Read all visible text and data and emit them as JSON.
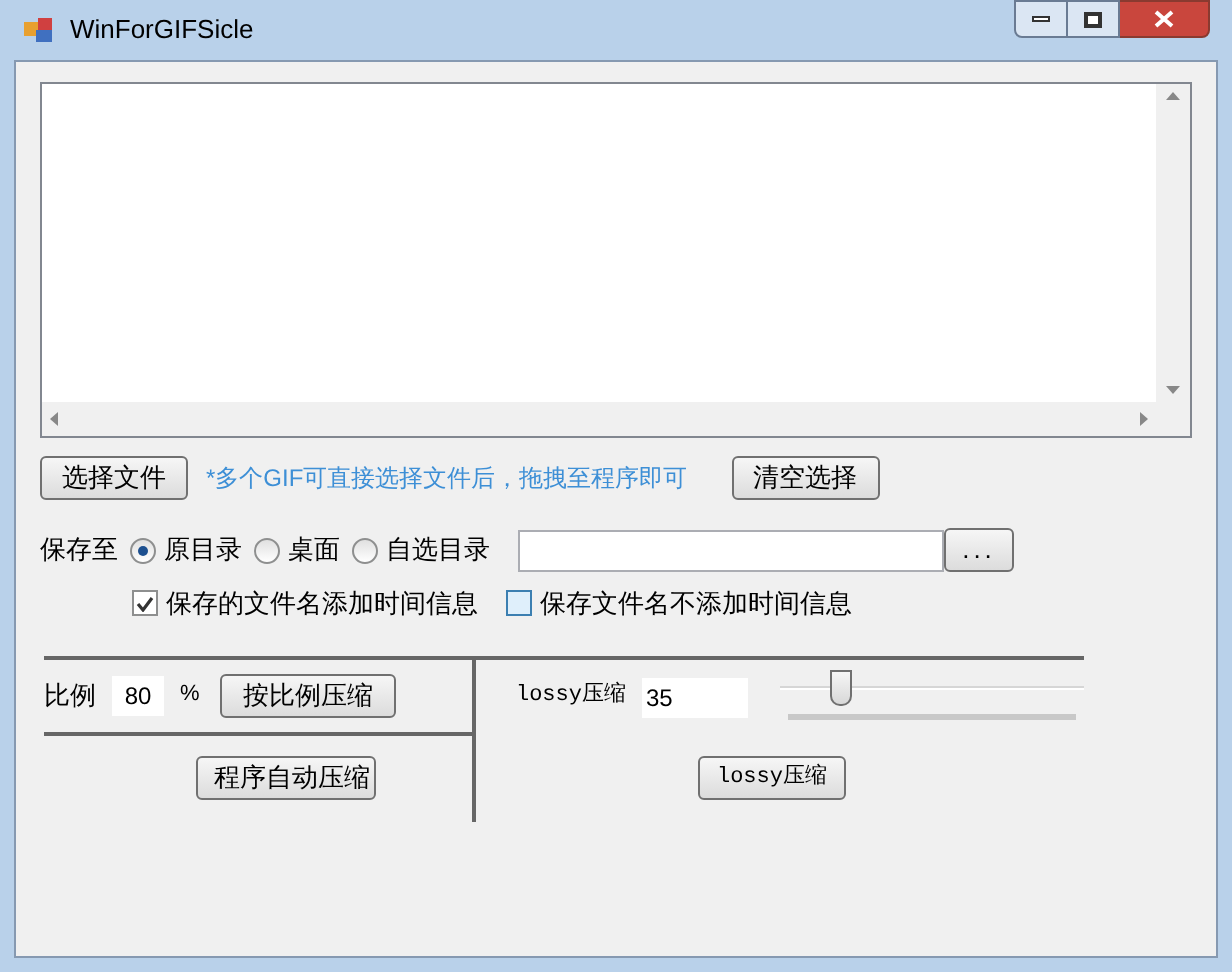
{
  "window": {
    "title": "WinForGIFSicle"
  },
  "select_button": "选择文件",
  "hint": "*多个GIF可直接选择文件后，拖拽至程序即可",
  "clear_button": "清空选择",
  "save_to": {
    "label": "保存至",
    "options": [
      {
        "label": "原目录",
        "selected": true
      },
      {
        "label": "桌面",
        "selected": false
      },
      {
        "label": "自选目录",
        "selected": false
      }
    ],
    "browse_button": "..."
  },
  "checkboxes": [
    {
      "label": "保存的文件名添加时间信息",
      "checked": true
    },
    {
      "label": "保存文件名不添加时间信息",
      "checked": false
    }
  ],
  "ratio": {
    "label": "比例",
    "value": "80",
    "unit": "%",
    "button": "按比例压缩"
  },
  "auto_button": "程序自动压缩",
  "lossy": {
    "label": "lossy压缩",
    "value": "35",
    "level": 0.18,
    "button": "lossy压缩"
  }
}
